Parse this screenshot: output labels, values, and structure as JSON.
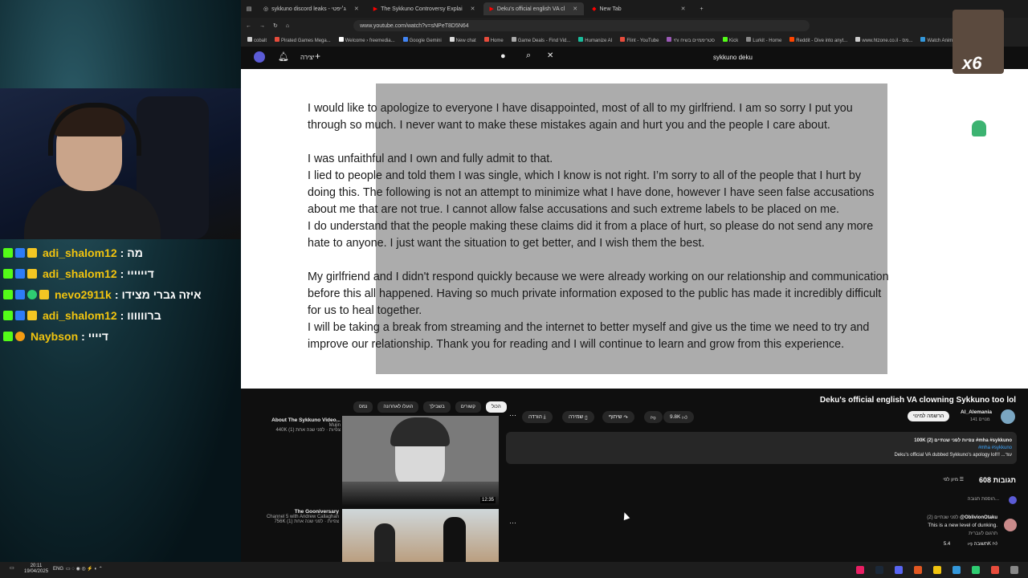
{
  "chat": {
    "messages": [
      {
        "user": "adi_shalom12",
        "text": "מה"
      },
      {
        "user": "adi_shalom12",
        "text": "דיייייי"
      },
      {
        "user": "nevo2911k",
        "text": "איזה גברי מצידו"
      },
      {
        "user": "adi_shalom12",
        "text": "ברוווווו"
      },
      {
        "user": "Naybson",
        "text": "דיייי"
      }
    ]
  },
  "browser": {
    "tabs": [
      {
        "label": "sykkuno discord leaks - ג׳יפטי"
      },
      {
        "label": "The Sykkuno Controversy Explai"
      },
      {
        "label": "Deku's official english VA cl"
      },
      {
        "label": "New Tab"
      }
    ],
    "url": "www.youtube.com/watch?v=sNPeT8D5N64",
    "bookmarks": [
      "cobalt",
      "Pirated Games Mega...",
      "Welcome › freemedia...",
      "Google Gemini",
      "New chat",
      "Home",
      "Game Deals - Find Vid...",
      "Humanize AI",
      "Flint - YouTube",
      "סטריממיים בשיח וחי",
      "Kick",
      "Lurkit - Home",
      "Reddit - Dive into anyt...",
      "www.htzone.co.il - מס...",
      "Watch Anime O"
    ]
  },
  "yt_header": {
    "search_query": "sykkuno deku",
    "create_label": "יצירה"
  },
  "player": {
    "paragraphs": [
      [
        "I would like to apologize to everyone I have disappointed, most of all to my girlfriend. I am so sorry I put you",
        "through so much. I never want to make these mistakes again and hurt you and the people I care about."
      ],
      [
        "I was unfaithful and I own and fully admit to that.",
        "I lied to people and told them I was single, which I know is not right. I’m sorry to all of the people that I hurt by",
        "doing this. The following is not an attempt to minimize what I have done, however I have seen false accusations",
        "about me that are not true. I cannot allow false accusations and such extreme labels to be placed on me.",
        "I do understand that the people making these claims did it from a place of hurt, so please do not send any more",
        "hate to anyone. I just want the situation to get better, and I wish them the best."
      ],
      [
        "My girlfriend and I didn't respond quickly because we were already working on our relationship and communication",
        "before this all happened. Having so much private information exposed to the public has made it incredibly difficult",
        "for us to heal together.",
        "I will be taking a break from streaming and the internet to better myself and give us the time we need to try and",
        "improve our relationship. Thank you for reading and I will continue to learn and grow from this experience."
      ]
    ]
  },
  "watch": {
    "chips": [
      "נמס",
      "הועלו לאחרונה",
      "בשבילך",
      "קשורים",
      "הכול"
    ],
    "video_title": "Deku's official english VA clowning Sykkuno too lol",
    "channel": "Al_Alemania",
    "subs": "141 מנויים",
    "subscribe_label": "הרשמה למינוי",
    "likes": "9.8K",
    "share_label": "שיתוף",
    "save_label": "שמירה",
    "download_label": "הורדה",
    "description_line1": "100K צפיות לפני שנתיים (2) #mha #sykkuno",
    "description_tags": "#mha #sykkuno",
    "description_line2": "Deku's official VA dubbed Sykkuno's apology lol!!! ...עוד",
    "comments_count": "608 תגובות",
    "sort_label": "מיון לפי",
    "add_comment": "הוספת תגובה...",
    "comment_user": "@OblivionOtaku",
    "comment_time": "לפני שנתיים (2)",
    "comment_text": "This is a new level of dunking.",
    "comment_translate": "תרגום לעברית",
    "comment_likes": "5.4K",
    "reply_label": "תשובה",
    "recs": [
      {
        "title": "About The Sykkuno Video...",
        "channel": "Mujin",
        "meta": "440K צפיות · לפני שנה אחת (1)",
        "duration": "12:35"
      },
      {
        "title": "The Gooniversary",
        "channel": "Channel 5 with Andrew Callaghan",
        "meta": "756K צפיות · לפני שנה אחת (1)",
        "duration": ""
      }
    ]
  },
  "overlay": {
    "multiplier": "x6"
  },
  "taskbar": {
    "time": "20:11",
    "date": "19/04/2025",
    "lang": "ENG"
  }
}
